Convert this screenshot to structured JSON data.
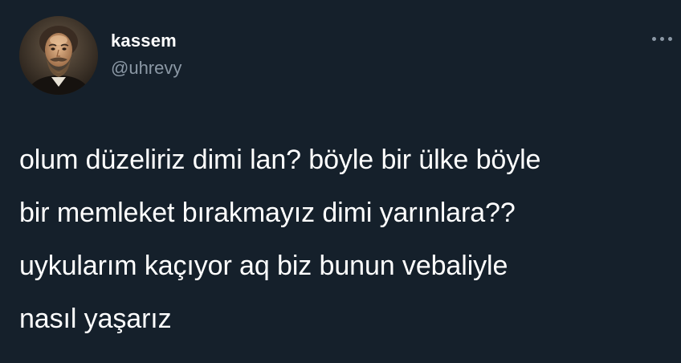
{
  "user": {
    "display_name": "kassem",
    "handle": "@uhrevy",
    "avatar_icon": "portrait-avatar"
  },
  "menu": {
    "icon": "more-options-icon"
  },
  "tweet": {
    "text": "olum düzeliriz dimi lan? böyle bir ülke böyle\nbir memleket bırakmayız dimi yarınlara??\nuykularım kaçıyor aq biz bunun vebaliyle\nnasıl yaşarız"
  },
  "colors": {
    "background": "#15202b",
    "primary_text": "#ffffff",
    "secondary_text": "#8b98a5"
  }
}
